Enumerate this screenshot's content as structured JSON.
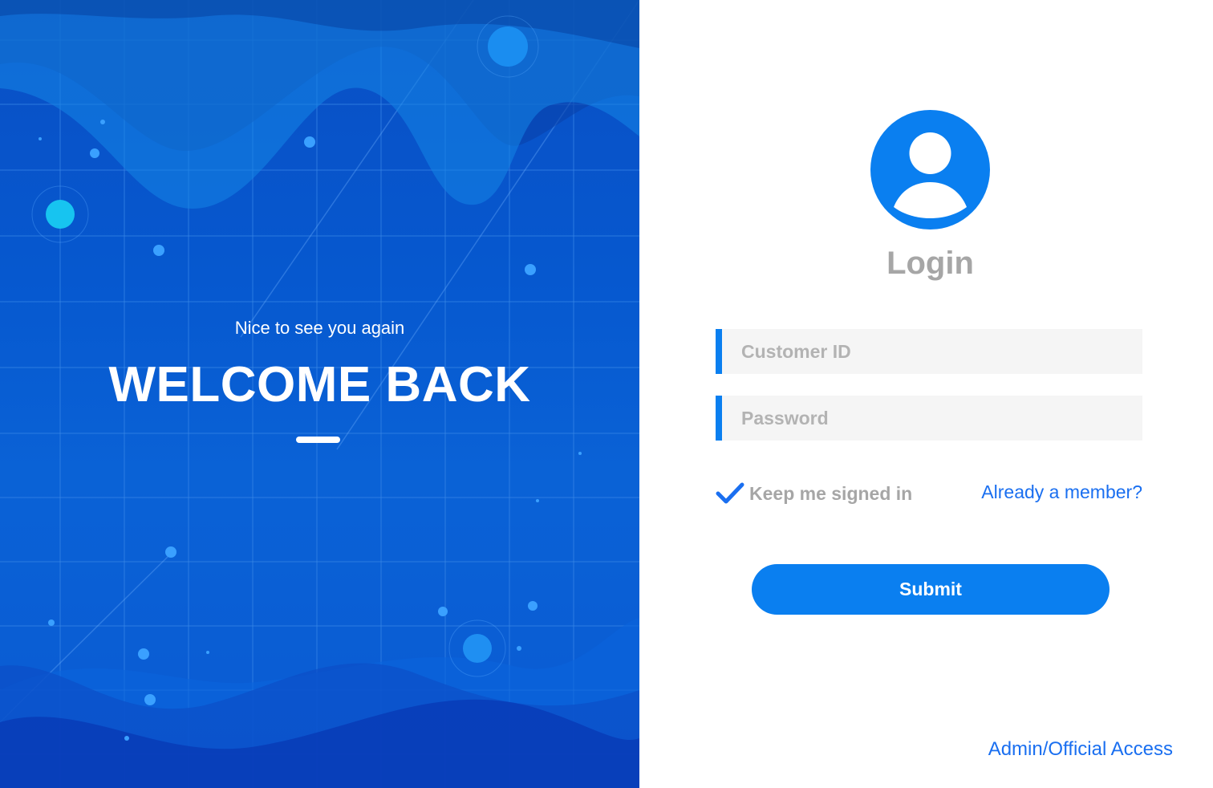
{
  "hero": {
    "tagline": "Nice to see you again",
    "headline": "WELCOME BACK"
  },
  "login": {
    "title": "Login",
    "customer_id": {
      "value": "",
      "placeholder": "Customer ID"
    },
    "password": {
      "value": "",
      "placeholder": "Password"
    },
    "keep_signed_in": {
      "label": "Keep me signed in",
      "checked": true
    },
    "member_link": "Already a member?",
    "submit_label": "Submit",
    "admin_link": "Admin/Official Access"
  },
  "icons": {
    "avatar": "user-avatar-icon",
    "check": "checkmark-icon"
  },
  "colors": {
    "accent": "#0a7ff0",
    "link": "#1a6ff0",
    "hero_blue": "#0658cf",
    "muted_text": "#a6a6a6",
    "field_bg": "#f5f5f5"
  }
}
